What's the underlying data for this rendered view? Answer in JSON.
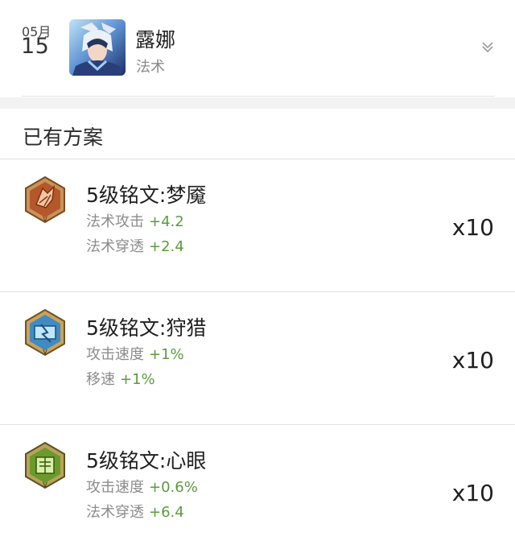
{
  "header": {
    "date_month": "05月",
    "date_day": "15",
    "hero_name": "露娜",
    "hero_role": "法术"
  },
  "section": {
    "title": "已有方案"
  },
  "runes": [
    {
      "name": "5级铭文:梦魇",
      "stats": [
        {
          "label": "法术攻击",
          "bonus": "+4.2"
        },
        {
          "label": "法术穿透",
          "bonus": "+2.4"
        }
      ],
      "count": "x10",
      "icon": "red-rune-icon",
      "color": "#b4572a"
    },
    {
      "name": "5级铭文:狩猎",
      "stats": [
        {
          "label": "攻击速度",
          "bonus": "+1%"
        },
        {
          "label": "移速",
          "bonus": "+1%"
        }
      ],
      "count": "x10",
      "icon": "blue-rune-icon",
      "color": "#3f8bc2"
    },
    {
      "name": "5级铭文:心眼",
      "stats": [
        {
          "label": "攻击速度",
          "bonus": "+0.6%"
        },
        {
          "label": "法术穿透",
          "bonus": "+6.4"
        }
      ],
      "count": "x10",
      "icon": "green-rune-icon",
      "color": "#6a9a2c"
    }
  ],
  "colors": {
    "bonus_green": "#5b9b3d",
    "divider": "#e0e0e0"
  }
}
